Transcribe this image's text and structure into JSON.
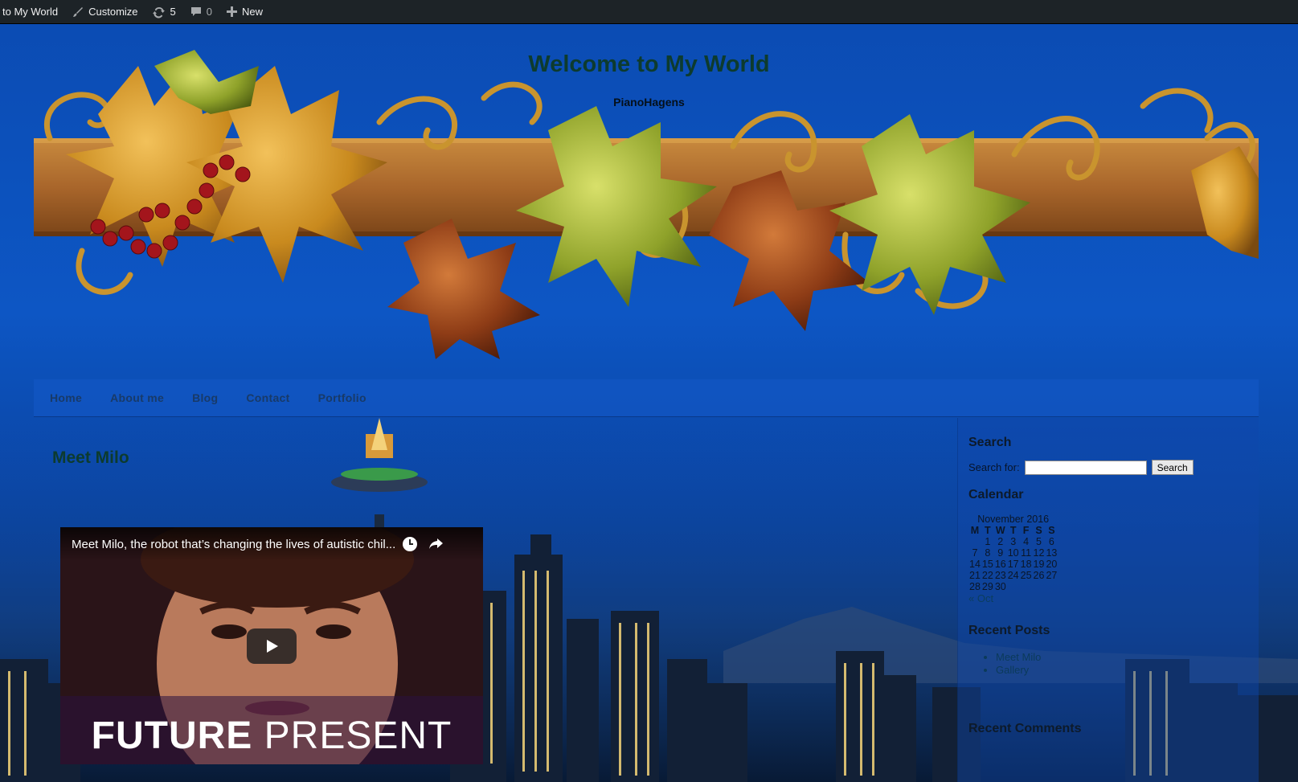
{
  "admin_bar": {
    "site": "to My World",
    "customize": "Customize",
    "updates": "5",
    "comments": "0",
    "new": "New"
  },
  "header": {
    "title": "Welcome to My World",
    "tagline": "PianoHagens"
  },
  "nav": [
    "Home",
    "About me",
    "Blog",
    "Contact",
    "Portfolio"
  ],
  "post": {
    "title": "Meet Milo",
    "video": {
      "title": "Meet Milo, the robot that’s changing the lives of autistic chil...",
      "brand_bold": "FUTURE",
      "brand_light": "PRESENT"
    }
  },
  "sidebar": {
    "search": {
      "title": "Search",
      "label": "Search for:",
      "button": "Search",
      "value": ""
    },
    "calendar": {
      "title": "Calendar",
      "caption": "November 2016",
      "headers": [
        "M",
        "T",
        "W",
        "T",
        "F",
        "S",
        "S"
      ],
      "rows": [
        [
          "",
          "1",
          "2",
          "3",
          "4",
          "5",
          "6"
        ],
        [
          "7",
          "8",
          "9",
          "10",
          "11",
          "12",
          "13"
        ],
        [
          "14",
          "15",
          "16",
          "17",
          "18",
          "19",
          "20"
        ],
        [
          "21",
          "22",
          "23",
          "24",
          "25",
          "26",
          "27"
        ],
        [
          "28",
          "29",
          "30",
          "",
          "",
          "",
          ""
        ]
      ],
      "prev": "« Oct"
    },
    "recent_posts": {
      "title": "Recent Posts",
      "items": [
        "Meet Milo",
        "Gallery"
      ]
    },
    "recent_comments": {
      "title": "Recent Comments"
    }
  },
  "colors": {
    "admin_bar": "#1d2327",
    "background": "#0d56c4",
    "title": "#0d3b2e"
  }
}
